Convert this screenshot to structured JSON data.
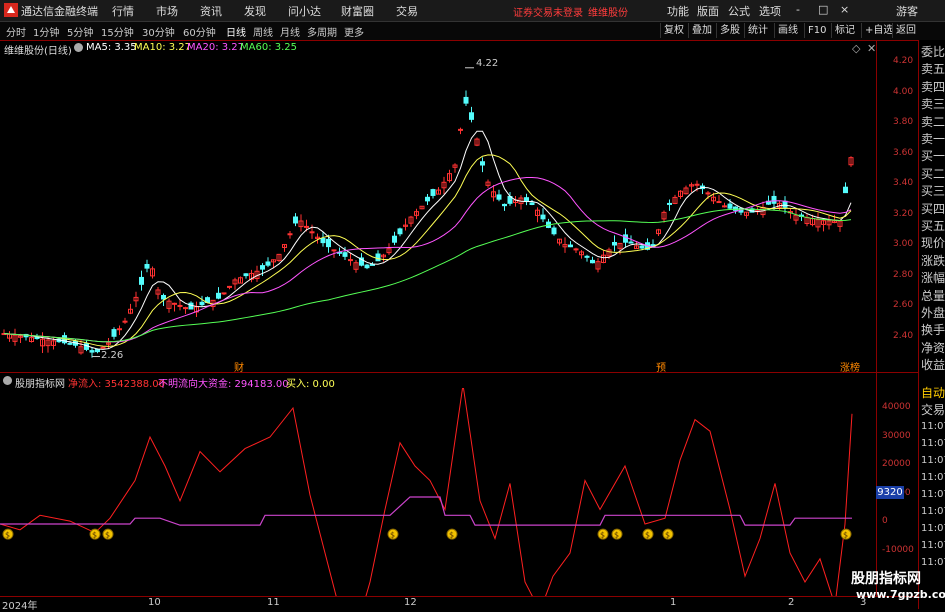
{
  "app": {
    "title": "通达信金融终端",
    "menu": [
      "行情",
      "市场",
      "资讯",
      "发现",
      "问小达",
      "财富圈",
      "交易"
    ],
    "warning": "证券交易未登录",
    "stock_tag": "维维股份",
    "right_menu": [
      "功能",
      "版面",
      "公式",
      "选项"
    ],
    "window_controls": [
      "-",
      "□",
      "×"
    ],
    "guest": "游客"
  },
  "toolbar": {
    "periods": [
      "分时",
      "1分钟",
      "5分钟",
      "15分钟",
      "30分钟",
      "60分钟",
      "日线",
      "周线",
      "月线",
      "多周期",
      "更多"
    ],
    "active_period": "日线",
    "buttons": [
      "复权",
      "叠加",
      "多股",
      "统计",
      "画线",
      "F10",
      "标记",
      "+自选",
      "返回"
    ]
  },
  "main_chart": {
    "stock_label": "维维股份(日线)",
    "ma": [
      {
        "label": "MA5: 3.35",
        "color": "#ffffff"
      },
      {
        "label": "MA10: 3.27",
        "color": "#ffff55"
      },
      {
        "label": "MA20: 3.27",
        "color": "#ff55ff"
      },
      {
        "label": "MA60: 3.25",
        "color": "#55ff55"
      }
    ],
    "high_label": "4.22",
    "low_label": "2.26",
    "y_ticks": [
      "4.20",
      "4.00",
      "3.80",
      "3.60",
      "3.40",
      "3.20",
      "3.00",
      "2.80",
      "2.60",
      "2.40"
    ],
    "event_labels": [
      "财",
      "预",
      "涨榜"
    ]
  },
  "right_panel": {
    "items": [
      "委比",
      "卖五",
      "卖四",
      "卖三",
      "卖二",
      "卖一",
      "买一",
      "买二",
      "买三",
      "买四",
      "买五",
      "现价",
      "涨跌",
      "涨幅",
      "总量",
      "外盘",
      "换手",
      "净资",
      "收益"
    ],
    "auto_label": "自动",
    "trade_label": "交易",
    "times": [
      "11:07",
      "11:07",
      "11:07",
      "11:07",
      "11:07",
      "11:07",
      "11:07",
      "11:07",
      "11:07"
    ]
  },
  "indicator": {
    "name": "股朋指标网",
    "inflow": "净流入: 3542388.00",
    "unclear": "不明流向大资金: 294183.00",
    "buy": "买入: 0.00",
    "y_ticks": [
      "40000",
      "30000",
      "20000",
      "10000",
      "0",
      "-10000"
    ],
    "current_value": "9320"
  },
  "date_axis": [
    "2024年",
    "10",
    "11",
    "12",
    "1",
    "2",
    "3"
  ],
  "watermark": {
    "line1": "股朋指标网",
    "line2": "www.7gpzb.com"
  },
  "colors": {
    "up": "#ff3232",
    "down": "#54fcfc",
    "ma5": "#ffffff",
    "ma10": "#ffff55",
    "ma20": "#ff55ff",
    "ma60": "#55ff55",
    "flow": "#ff2020",
    "flow2": "#cc44cc"
  }
}
